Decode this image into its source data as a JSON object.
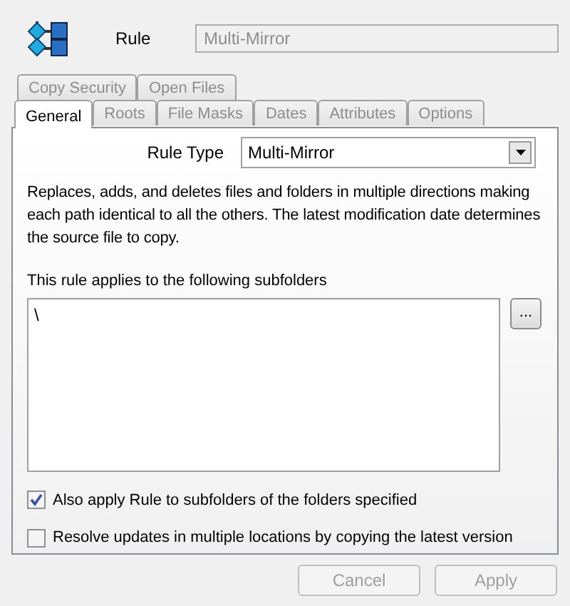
{
  "header": {
    "label": "Rule",
    "name_field": {
      "value": "Multi-Mirror",
      "disabled": true
    }
  },
  "tab_rows": [
    [
      {
        "label": "Copy Security",
        "selected": false,
        "disabled": true
      },
      {
        "label": "Open Files",
        "selected": false,
        "disabled": true
      }
    ],
    [
      {
        "label": "General",
        "selected": true,
        "disabled": false
      },
      {
        "label": "Roots",
        "selected": false,
        "disabled": true
      },
      {
        "label": "File Masks",
        "selected": false,
        "disabled": true
      },
      {
        "label": "Dates",
        "selected": false,
        "disabled": true
      },
      {
        "label": "Attributes",
        "selected": false,
        "disabled": true
      },
      {
        "label": "Options",
        "selected": false,
        "disabled": true
      }
    ]
  ],
  "rule_type": {
    "label": "Rule Type",
    "value": "Multi-Mirror"
  },
  "description": "Replaces, adds, and deletes files and folders in multiple directions making each path identical to all the others. The latest modification date determines the source file to copy.",
  "subfolders": {
    "label": "This rule applies to the following subfolders",
    "items": [
      "\\"
    ],
    "browse_button": "..."
  },
  "options": [
    {
      "label": "Also apply Rule to subfolders of the folders specified",
      "checked": true
    },
    {
      "label": "Resolve updates in multiple locations by copying the latest version",
      "checked": false
    }
  ],
  "buttons": [
    {
      "label": "Cancel",
      "disabled": true
    },
    {
      "label": "Apply",
      "disabled": true
    }
  ]
}
